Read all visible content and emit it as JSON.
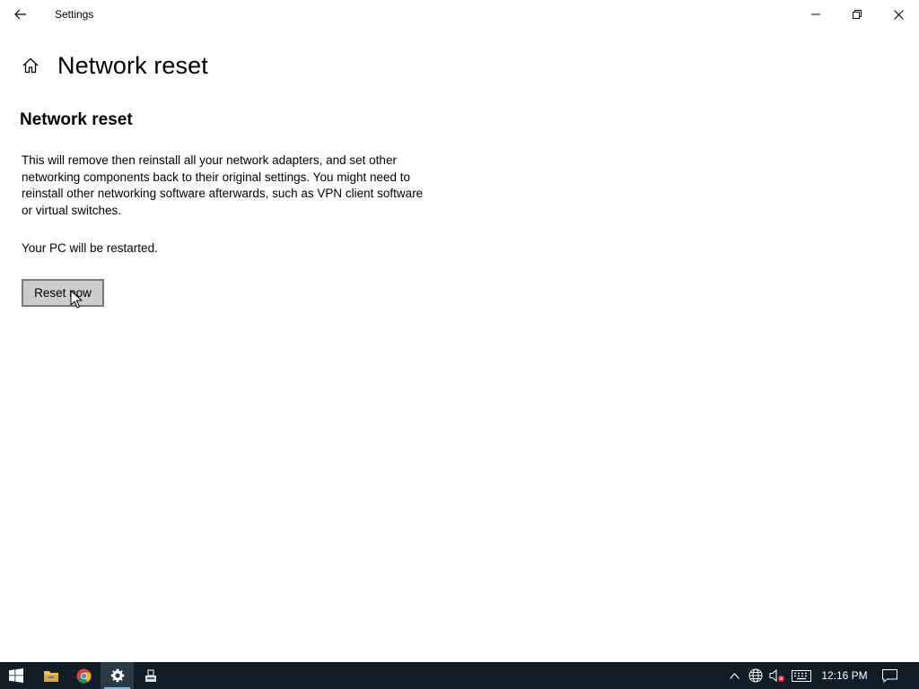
{
  "window": {
    "title": "Settings"
  },
  "header": {
    "page_title": "Network reset"
  },
  "content": {
    "section_title": "Network reset",
    "description": "This will remove then reinstall all your network adapters, and set other networking components back to their original settings. You might need to reinstall other networking software afterwards, such as VPN client software or virtual switches.",
    "restart_note": "Your PC will be restarted.",
    "reset_button_label": "Reset now"
  },
  "taskbar": {
    "apps": [
      {
        "name": "file-explorer",
        "icon": "folder-icon"
      },
      {
        "name": "chrome",
        "icon": "chrome-icon"
      },
      {
        "name": "settings",
        "icon": "gear-icon",
        "active": true
      },
      {
        "name": "other-app",
        "icon": "app-icon"
      }
    ],
    "clock": "12:16 PM"
  },
  "colors": {
    "taskbar_bg": "#101c26",
    "button_bg": "#cccccc",
    "button_border": "#7a7a7a",
    "accent": "#7bb6e6"
  }
}
